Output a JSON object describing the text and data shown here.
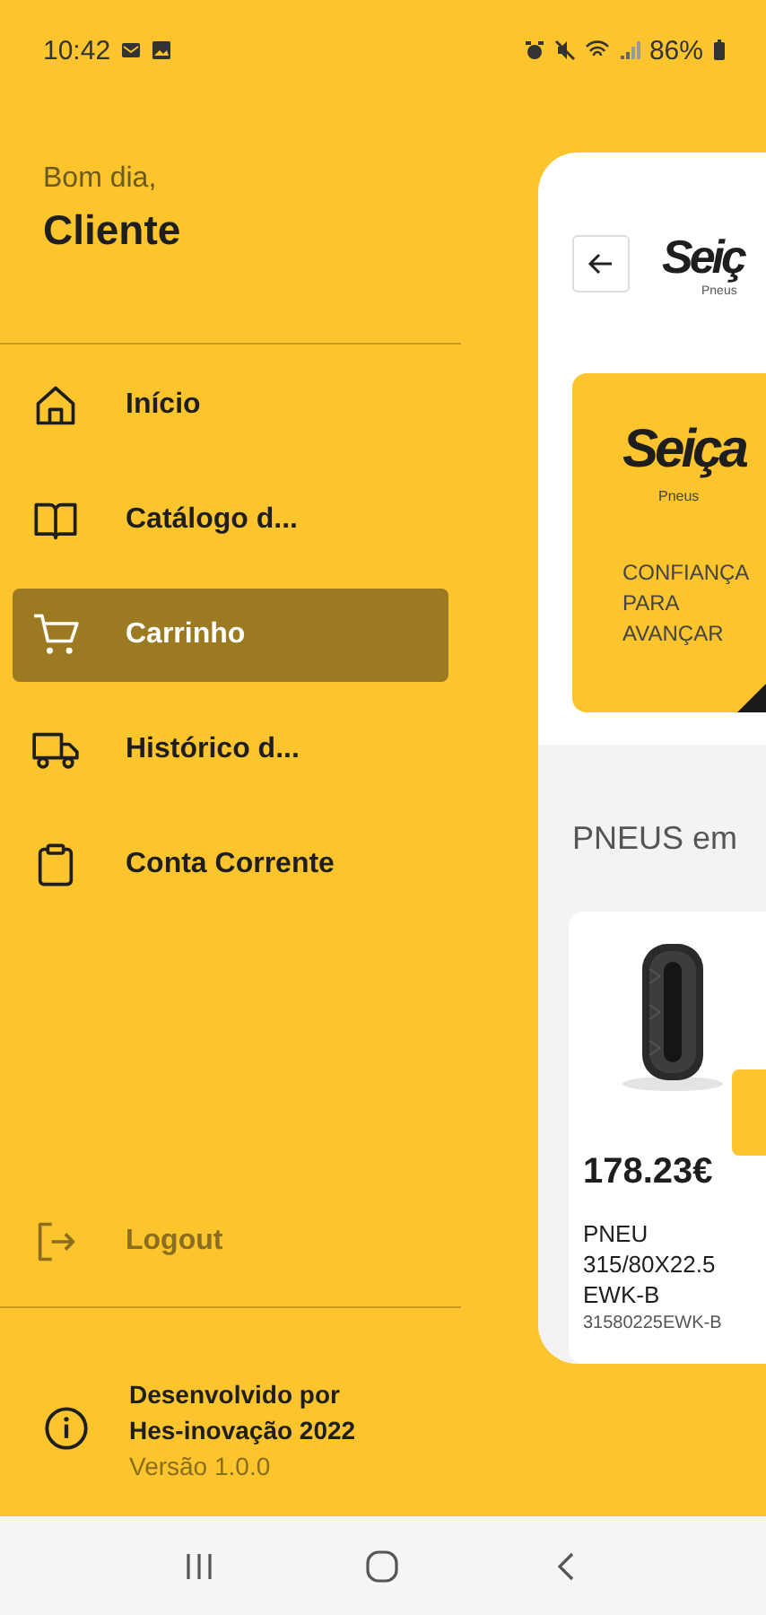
{
  "status_bar": {
    "time": "10:42",
    "battery": "86%"
  },
  "drawer": {
    "greeting": "Bom dia,",
    "user_name": "Cliente",
    "items": [
      {
        "label": "Início",
        "kind": "home",
        "selected": false
      },
      {
        "label": "Catálogo d...",
        "kind": "book",
        "selected": false
      },
      {
        "label": "Carrinho",
        "kind": "cart",
        "selected": true
      },
      {
        "label": "Histórico d...",
        "kind": "truck",
        "selected": false
      },
      {
        "label": "Conta Corrente",
        "kind": "clipboard",
        "selected": false
      }
    ],
    "logout": {
      "label": "Logout",
      "disabled": true
    },
    "footer": {
      "credit": "Desenvolvido por Hes-inovação 2022",
      "version": "Versão 1.0.0"
    }
  },
  "page": {
    "logo": "Seiç",
    "logo_sub": "Pneus",
    "banner": {
      "logo": "Seiça",
      "logo_sub": "Pneus",
      "slogan": [
        "CONFIANÇA",
        "PARA",
        "AVANÇAR"
      ]
    },
    "section_title": "PNEUS em",
    "product": {
      "price": "178.23€",
      "name": "PNEU 315/80X22.5 EWK-B",
      "code": "31580225EWK-B"
    }
  }
}
